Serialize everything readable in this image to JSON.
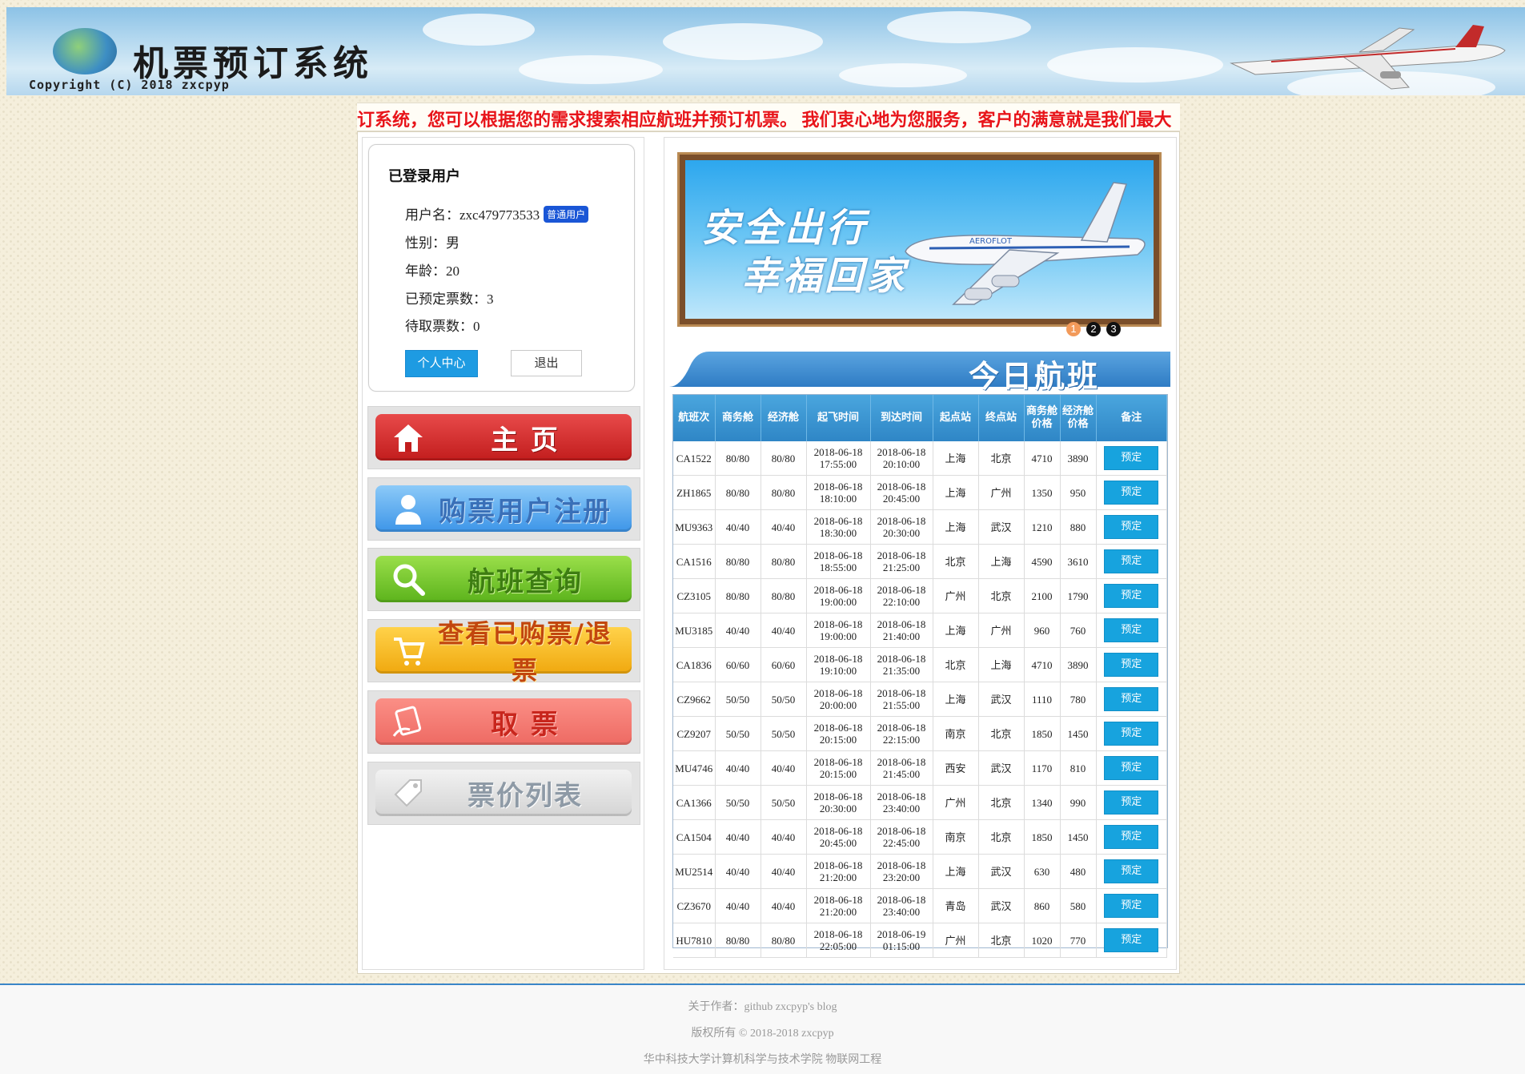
{
  "header": {
    "title": "机票预订系统",
    "copyright": "Copyright (C) 2018 zxcpyp"
  },
  "marquee": {
    "text": "订系统，您可以根据您的需求搜索相应航班并预订机票。    我们衷心地为您服务，客户的满意就是我们最大"
  },
  "user": {
    "section_title": "已登录用户",
    "username": "用户名：zxc479773533",
    "badge": "普通用户",
    "gender": "性别：男",
    "age": "年龄：20",
    "booked": "已预定票数：3",
    "pending": "待取票数：0",
    "personal_center_label": "个人中心",
    "logout_label": "退出"
  },
  "nav": {
    "home": "主 页",
    "register": "购票用户注册",
    "search": "航班查询",
    "my_tickets": "查看已购票/退票",
    "pickup": "取 票",
    "price_list": "票价列表"
  },
  "carousel": {
    "slogan_line1": "安全出行",
    "slogan_line2": "幸福回家",
    "dots": [
      "1",
      "2",
      "3"
    ],
    "active_dot": 1
  },
  "today": {
    "title": "今日航班"
  },
  "table": {
    "headers": [
      "航班次",
      "商务舱",
      "经济舱",
      "起飞时间",
      "到达时间",
      "起点站",
      "终点站",
      "商务舱价格",
      "经济舱价格",
      "备注"
    ],
    "book_label": "预定",
    "rows": [
      {
        "flight": "CA1522",
        "biz": "80/80",
        "eco": "80/80",
        "dep_date": "2018-06-18",
        "dep_time": "17:55:00",
        "arr_date": "2018-06-18",
        "arr_time": "20:10:00",
        "from": "上海",
        "to": "北京",
        "biz_price": "4710",
        "eco_price": "3890"
      },
      {
        "flight": "ZH1865",
        "biz": "80/80",
        "eco": "80/80",
        "dep_date": "2018-06-18",
        "dep_time": "18:10:00",
        "arr_date": "2018-06-18",
        "arr_time": "20:45:00",
        "from": "上海",
        "to": "广州",
        "biz_price": "1350",
        "eco_price": "950"
      },
      {
        "flight": "MU9363",
        "biz": "40/40",
        "eco": "40/40",
        "dep_date": "2018-06-18",
        "dep_time": "18:30:00",
        "arr_date": "2018-06-18",
        "arr_time": "20:30:00",
        "from": "上海",
        "to": "武汉",
        "biz_price": "1210",
        "eco_price": "880"
      },
      {
        "flight": "CA1516",
        "biz": "80/80",
        "eco": "80/80",
        "dep_date": "2018-06-18",
        "dep_time": "18:55:00",
        "arr_date": "2018-06-18",
        "arr_time": "21:25:00",
        "from": "北京",
        "to": "上海",
        "biz_price": "4590",
        "eco_price": "3610"
      },
      {
        "flight": "CZ3105",
        "biz": "80/80",
        "eco": "80/80",
        "dep_date": "2018-06-18",
        "dep_time": "19:00:00",
        "arr_date": "2018-06-18",
        "arr_time": "22:10:00",
        "from": "广州",
        "to": "北京",
        "biz_price": "2100",
        "eco_price": "1790"
      },
      {
        "flight": "MU3185",
        "biz": "40/40",
        "eco": "40/40",
        "dep_date": "2018-06-18",
        "dep_time": "19:00:00",
        "arr_date": "2018-06-18",
        "arr_time": "21:40:00",
        "from": "上海",
        "to": "广州",
        "biz_price": "960",
        "eco_price": "760"
      },
      {
        "flight": "CA1836",
        "biz": "60/60",
        "eco": "60/60",
        "dep_date": "2018-06-18",
        "dep_time": "19:10:00",
        "arr_date": "2018-06-18",
        "arr_time": "21:35:00",
        "from": "北京",
        "to": "上海",
        "biz_price": "4710",
        "eco_price": "3890"
      },
      {
        "flight": "CZ9662",
        "biz": "50/50",
        "eco": "50/50",
        "dep_date": "2018-06-18",
        "dep_time": "20:00:00",
        "arr_date": "2018-06-18",
        "arr_time": "21:55:00",
        "from": "上海",
        "to": "武汉",
        "biz_price": "1110",
        "eco_price": "780"
      },
      {
        "flight": "CZ9207",
        "biz": "50/50",
        "eco": "50/50",
        "dep_date": "2018-06-18",
        "dep_time": "20:15:00",
        "arr_date": "2018-06-18",
        "arr_time": "22:15:00",
        "from": "南京",
        "to": "北京",
        "biz_price": "1850",
        "eco_price": "1450"
      },
      {
        "flight": "MU4746",
        "biz": "40/40",
        "eco": "40/40",
        "dep_date": "2018-06-18",
        "dep_time": "20:15:00",
        "arr_date": "2018-06-18",
        "arr_time": "21:45:00",
        "from": "西安",
        "to": "武汉",
        "biz_price": "1170",
        "eco_price": "810"
      },
      {
        "flight": "CA1366",
        "biz": "50/50",
        "eco": "50/50",
        "dep_date": "2018-06-18",
        "dep_time": "20:30:00",
        "arr_date": "2018-06-18",
        "arr_time": "23:40:00",
        "from": "广州",
        "to": "北京",
        "biz_price": "1340",
        "eco_price": "990"
      },
      {
        "flight": "CA1504",
        "biz": "40/40",
        "eco": "40/40",
        "dep_date": "2018-06-18",
        "dep_time": "20:45:00",
        "arr_date": "2018-06-18",
        "arr_time": "22:45:00",
        "from": "南京",
        "to": "北京",
        "biz_price": "1850",
        "eco_price": "1450"
      },
      {
        "flight": "MU2514",
        "biz": "40/40",
        "eco": "40/40",
        "dep_date": "2018-06-18",
        "dep_time": "21:20:00",
        "arr_date": "2018-06-18",
        "arr_time": "23:20:00",
        "from": "上海",
        "to": "武汉",
        "biz_price": "630",
        "eco_price": "480"
      },
      {
        "flight": "CZ3670",
        "biz": "40/40",
        "eco": "40/40",
        "dep_date": "2018-06-18",
        "dep_time": "21:20:00",
        "arr_date": "2018-06-18",
        "arr_time": "23:40:00",
        "from": "青岛",
        "to": "武汉",
        "biz_price": "860",
        "eco_price": "580"
      },
      {
        "flight": "HU7810",
        "biz": "80/80",
        "eco": "80/80",
        "dep_date": "2018-06-18",
        "dep_time": "22:05:00",
        "arr_date": "2018-06-19",
        "arr_time": "01:15:00",
        "from": "广州",
        "to": "北京",
        "biz_price": "1020",
        "eco_price": "770"
      }
    ]
  },
  "footer": {
    "author": "关于作者：github zxcpyp's blog",
    "copyright": "版权所有 © 2018-2018 zxcpyp",
    "school": "华中科技大学计算机科学与技术学院 物联网工程"
  },
  "colors": {
    "accent": "#1e9be2",
    "marquee": "#e8141a",
    "table_header": "#3a90cd"
  }
}
